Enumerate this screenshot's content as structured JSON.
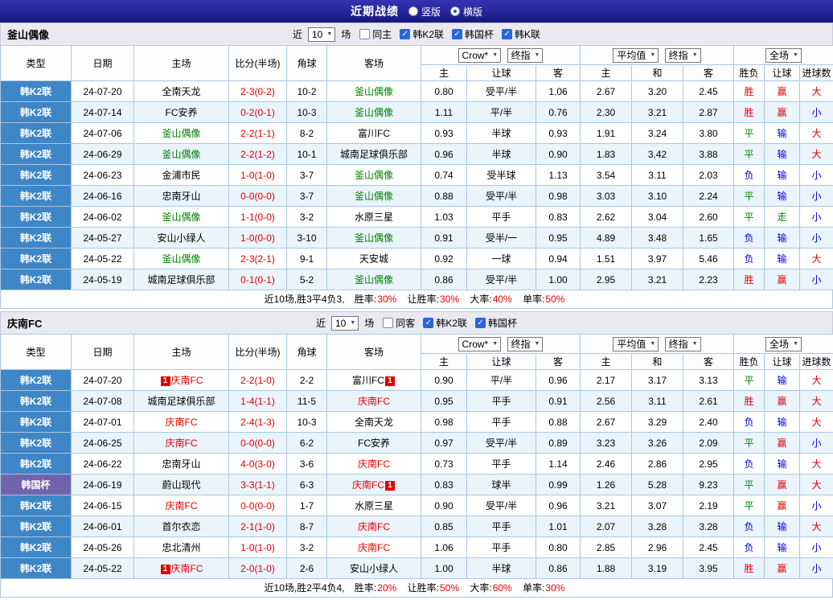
{
  "icons": {
    "dropdown_arrow": "▼",
    "checkmark": "✓"
  },
  "colors": {
    "league_blue": "#3e86c6",
    "cup_purple": "#7263ad",
    "team_green": "#008000",
    "team_red": "#e60000",
    "score_red": "#e60000"
  },
  "result_colors": {
    "胜": "#e60000",
    "平": "#008800",
    "负": "#0000dd",
    "赢": "#e60000",
    "输": "#0000dd",
    "走": "#008800",
    "大": "#e60000",
    "小": "#0000dd"
  },
  "topbar": {
    "title": "近期战绩",
    "radios": [
      {
        "label": "竖版",
        "checked": false
      },
      {
        "label": "横版",
        "checked": true
      }
    ]
  },
  "filter_labels": {
    "near": "近",
    "games": "场"
  },
  "table_header": {
    "type": "类型",
    "date": "日期",
    "home": "主场",
    "score": "比分(半场)",
    "corner": "角球",
    "away": "客场",
    "odds1_select_a": "Crow*",
    "odds1_select_b": "终指",
    "odds2_select_a": "平均值",
    "odds2_select_b": "终指",
    "result_select": "全场",
    "o1_home": "主",
    "o1_handicap": "让球",
    "o1_away": "客",
    "o2_home": "主",
    "o2_draw": "和",
    "o2_away": "客",
    "r_result": "胜负",
    "r_handicap": "让球",
    "r_goals": "进球数"
  },
  "sections": [
    {
      "team": "釜山偶像",
      "filter": {
        "count": "10",
        "options": [
          {
            "label": "同主",
            "checked": false
          },
          {
            "label": "韩K2联",
            "checked": true
          },
          {
            "label": "韩国杯",
            "checked": true
          },
          {
            "label": "韩K联",
            "checked": true
          }
        ]
      },
      "rows": [
        {
          "league": "韩K2联",
          "date": "24-07-20",
          "home": {
            "name": "全南天龙"
          },
          "score": "2-3(0-2)",
          "corner": "10-2",
          "away": {
            "name": "釜山偶像",
            "color": "green"
          },
          "odds": [
            "0.80",
            "受平/半",
            "1.06",
            "2.67",
            "3.20",
            "2.45"
          ],
          "results": [
            "胜",
            "赢",
            "大"
          ]
        },
        {
          "league": "韩K2联",
          "date": "24-07-14",
          "home": {
            "name": "FC安养"
          },
          "score": "0-2(0-1)",
          "corner": "10-3",
          "away": {
            "name": "釜山偶像",
            "color": "green"
          },
          "odds": [
            "1.11",
            "平/半",
            "0.76",
            "2.30",
            "3.21",
            "2.87"
          ],
          "results": [
            "胜",
            "赢",
            "小"
          ]
        },
        {
          "league": "韩K2联",
          "date": "24-07-06",
          "home": {
            "name": "釜山偶像",
            "color": "green"
          },
          "score": "2-2(1-1)",
          "corner": "8-2",
          "away": {
            "name": "富川FC"
          },
          "odds": [
            "0.93",
            "半球",
            "0.93",
            "1.91",
            "3.24",
            "3.80"
          ],
          "results": [
            "平",
            "输",
            "大"
          ]
        },
        {
          "league": "韩K2联",
          "date": "24-06-29",
          "home": {
            "name": "釜山偶像",
            "color": "green"
          },
          "score": "2-2(1-2)",
          "corner": "10-1",
          "away": {
            "name": "城南足球俱乐部"
          },
          "odds": [
            "0.96",
            "半球",
            "0.90",
            "1.83",
            "3.42",
            "3.88"
          ],
          "results": [
            "平",
            "输",
            "大"
          ]
        },
        {
          "league": "韩K2联",
          "date": "24-06-23",
          "home": {
            "name": "金浦市民"
          },
          "score": "1-0(1-0)",
          "corner": "3-7",
          "away": {
            "name": "釜山偶像",
            "color": "green"
          },
          "odds": [
            "0.74",
            "受半球",
            "1.13",
            "3.54",
            "3.11",
            "2.03"
          ],
          "results": [
            "负",
            "输",
            "小"
          ]
        },
        {
          "league": "韩K2联",
          "date": "24-06-16",
          "home": {
            "name": "忠南牙山"
          },
          "score": "0-0(0-0)",
          "corner": "3-7",
          "away": {
            "name": "釜山偶像",
            "color": "green"
          },
          "odds": [
            "0.88",
            "受平/半",
            "0.98",
            "3.03",
            "3.10",
            "2.24"
          ],
          "results": [
            "平",
            "输",
            "小"
          ]
        },
        {
          "league": "韩K2联",
          "date": "24-06-02",
          "home": {
            "name": "釜山偶像",
            "color": "green"
          },
          "score": "1-1(0-0)",
          "corner": "3-2",
          "away": {
            "name": "水原三星"
          },
          "odds": [
            "1.03",
            "平手",
            "0.83",
            "2.62",
            "3.04",
            "2.60"
          ],
          "results": [
            "平",
            "走",
            "小"
          ]
        },
        {
          "league": "韩K2联",
          "date": "24-05-27",
          "home": {
            "name": "安山小绿人"
          },
          "score": "1-0(0-0)",
          "corner": "3-10",
          "away": {
            "name": "釜山偶像",
            "color": "green"
          },
          "odds": [
            "0.91",
            "受半/一",
            "0.95",
            "4.89",
            "3.48",
            "1.65"
          ],
          "results": [
            "负",
            "输",
            "小"
          ]
        },
        {
          "league": "韩K2联",
          "date": "24-05-22",
          "home": {
            "name": "釜山偶像",
            "color": "green"
          },
          "score": "2-3(2-1)",
          "corner": "9-1",
          "away": {
            "name": "天安城"
          },
          "odds": [
            "0.92",
            "一球",
            "0.94",
            "1.51",
            "3.97",
            "5.46"
          ],
          "results": [
            "负",
            "输",
            "大"
          ]
        },
        {
          "league": "韩K2联",
          "date": "24-05-19",
          "home": {
            "name": "城南足球俱乐部"
          },
          "score": "0-1(0-1)",
          "corner": "5-2",
          "away": {
            "name": "釜山偶像",
            "color": "green"
          },
          "odds": [
            "0.86",
            "受平/半",
            "1.00",
            "2.95",
            "3.21",
            "2.23"
          ],
          "results": [
            "胜",
            "赢",
            "小"
          ]
        }
      ],
      "summary": {
        "prefix": "近10场,胜3平4负3,",
        "stats": [
          {
            "label": "胜率:",
            "value": "30%"
          },
          {
            "label": "让胜率:",
            "value": "30%"
          },
          {
            "label": "大率:",
            "value": "40%"
          },
          {
            "label": "单率:",
            "value": "50%"
          }
        ]
      }
    },
    {
      "team": "庆南FC",
      "filter": {
        "count": "10",
        "options": [
          {
            "label": "同客",
            "checked": false
          },
          {
            "label": "韩K2联",
            "checked": true
          },
          {
            "label": "韩国杯",
            "checked": true
          }
        ]
      },
      "rows": [
        {
          "league": "韩K2联",
          "date": "24-07-20",
          "home": {
            "name": "庆南FC",
            "color": "red",
            "badge": "1",
            "badge_pos": "before"
          },
          "score": "2-2(1-0)",
          "corner": "2-2",
          "away": {
            "name": "富川FC",
            "badge": "1",
            "badge_pos": "after"
          },
          "odds": [
            "0.90",
            "平/半",
            "0.96",
            "2.17",
            "3.17",
            "3.13"
          ],
          "results": [
            "平",
            "输",
            "大"
          ]
        },
        {
          "league": "韩K2联",
          "date": "24-07-08",
          "home": {
            "name": "城南足球俱乐部"
          },
          "score": "1-4(1-1)",
          "corner": "11-5",
          "away": {
            "name": "庆南FC",
            "color": "red"
          },
          "odds": [
            "0.95",
            "平手",
            "0.91",
            "2.56",
            "3.11",
            "2.61"
          ],
          "results": [
            "胜",
            "赢",
            "大"
          ]
        },
        {
          "league": "韩K2联",
          "date": "24-07-01",
          "home": {
            "name": "庆南FC",
            "color": "red"
          },
          "score": "2-4(1-3)",
          "corner": "10-3",
          "away": {
            "name": "全南天龙"
          },
          "odds": [
            "0.98",
            "平手",
            "0.88",
            "2.67",
            "3.29",
            "2.40"
          ],
          "results": [
            "负",
            "输",
            "大"
          ]
        },
        {
          "league": "韩K2联",
          "date": "24-06-25",
          "home": {
            "name": "庆南FC",
            "color": "red"
          },
          "score": "0-0(0-0)",
          "corner": "6-2",
          "away": {
            "name": "FC安养"
          },
          "odds": [
            "0.97",
            "受平/半",
            "0.89",
            "3.23",
            "3.26",
            "2.09"
          ],
          "results": [
            "平",
            "赢",
            "小"
          ]
        },
        {
          "league": "韩K2联",
          "date": "24-06-22",
          "home": {
            "name": "忠南牙山"
          },
          "score": "4-0(3-0)",
          "corner": "3-6",
          "away": {
            "name": "庆南FC",
            "color": "red"
          },
          "odds": [
            "0.73",
            "平手",
            "1.14",
            "2.46",
            "2.86",
            "2.95"
          ],
          "results": [
            "负",
            "输",
            "大"
          ]
        },
        {
          "league": "韩国杯",
          "cup": true,
          "date": "24-06-19",
          "home": {
            "name": "蔚山现代"
          },
          "score": "3-3(1-1)",
          "corner": "6-3",
          "away": {
            "name": "庆南FC",
            "color": "red",
            "badge": "1",
            "badge_pos": "after"
          },
          "odds": [
            "0.83",
            "球半",
            "0.99",
            "1.26",
            "5.28",
            "9.23"
          ],
          "results": [
            "平",
            "赢",
            "大"
          ]
        },
        {
          "league": "韩K2联",
          "date": "24-06-15",
          "home": {
            "name": "庆南FC",
            "color": "red"
          },
          "score": "0-0(0-0)",
          "corner": "1-7",
          "away": {
            "name": "水原三星"
          },
          "odds": [
            "0.90",
            "受平/半",
            "0.96",
            "3.21",
            "3.07",
            "2.19"
          ],
          "results": [
            "平",
            "赢",
            "小"
          ]
        },
        {
          "league": "韩K2联",
          "date": "24-06-01",
          "home": {
            "name": "首尔衣恋"
          },
          "score": "2-1(1-0)",
          "corner": "8-7",
          "away": {
            "name": "庆南FC",
            "color": "red"
          },
          "odds": [
            "0.85",
            "平手",
            "1.01",
            "2.07",
            "3.28",
            "3.28"
          ],
          "results": [
            "负",
            "输",
            "大"
          ]
        },
        {
          "league": "韩K2联",
          "date": "24-05-26",
          "home": {
            "name": "忠北清州"
          },
          "score": "1-0(1-0)",
          "corner": "3-2",
          "away": {
            "name": "庆南FC",
            "color": "red"
          },
          "odds": [
            "1.06",
            "平手",
            "0.80",
            "2.85",
            "2.96",
            "2.45"
          ],
          "results": [
            "负",
            "输",
            "小"
          ]
        },
        {
          "league": "韩K2联",
          "date": "24-05-22",
          "home": {
            "name": "庆南FC",
            "color": "red",
            "badge": "1",
            "badge_pos": "before"
          },
          "score": "2-0(1-0)",
          "corner": "2-6",
          "away": {
            "name": "安山小绿人"
          },
          "odds": [
            "1.00",
            "半球",
            "0.86",
            "1.88",
            "3.19",
            "3.95"
          ],
          "results": [
            "胜",
            "赢",
            "小"
          ]
        }
      ],
      "summary": {
        "prefix": "近10场,胜2平4负4,",
        "stats": [
          {
            "label": "胜率:",
            "value": "20%"
          },
          {
            "label": "让胜率:",
            "value": "50%"
          },
          {
            "label": "大率:",
            "value": "60%"
          },
          {
            "label": "单率:",
            "value": "30%"
          }
        ]
      }
    }
  ]
}
